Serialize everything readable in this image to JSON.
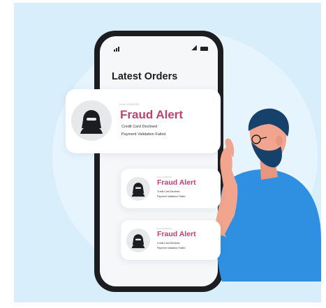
{
  "screen": {
    "title": "Latest Orders",
    "status_icons": [
      "signal-icon",
      "wifi-icon",
      "battery-icon"
    ]
  },
  "orders": [
    {
      "tag": "Order #0098765",
      "alert": "Fraud Alert",
      "line1": "Credit Card Declined",
      "line2": "Payment Validation Failed",
      "icon": "hacker-icon"
    },
    {
      "tag": "Order #0098765",
      "alert": "Fraud Alert",
      "line1": "Credit Card Declined",
      "line2": "Payment Validation Failed",
      "icon": "hacker-icon"
    },
    {
      "tag": "Order #0098765",
      "alert": "Fraud Alert",
      "line1": "Credit Card Declined",
      "line2": "Payment Validation Failed",
      "icon": "hacker-icon"
    }
  ],
  "colors": {
    "background": "#d9eefb",
    "alert": "#c2416c",
    "shirt": "#2f8fe0",
    "hair": "#16416b",
    "skin": "#f1a58e"
  }
}
